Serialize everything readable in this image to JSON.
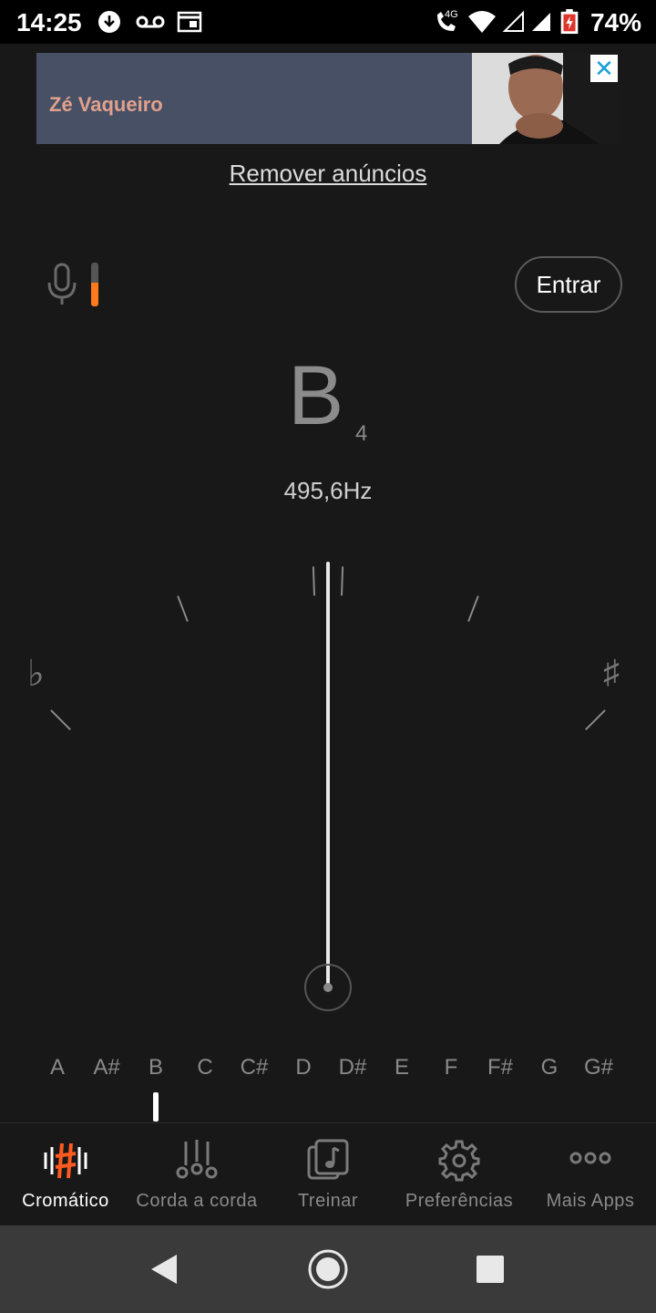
{
  "status_bar": {
    "time": "14:25",
    "network": "4G",
    "battery": "74%"
  },
  "ad": {
    "title": "Zé Vaqueiro",
    "close_icon": "close-icon"
  },
  "remove_ads_label": "Remover anúncios",
  "input_level_fraction": 0.55,
  "login_label": "Entrar",
  "tuner": {
    "note": "B",
    "octave": "4",
    "frequency": "495,6Hz",
    "flat_symbol": "♭",
    "sharp_symbol": "♯",
    "needle_cents": 0
  },
  "notes": [
    "A",
    "A#",
    "B",
    "C",
    "C#",
    "D",
    "D#",
    "E",
    "F",
    "F#",
    "G",
    "G#"
  ],
  "selected_note": "B",
  "nav": [
    {
      "label": "Cromático",
      "icon": "chromatic-icon",
      "active": true
    },
    {
      "label": "Corda a corda",
      "icon": "strings-icon",
      "active": false
    },
    {
      "label": "Treinar",
      "icon": "music-note-icon",
      "active": false
    },
    {
      "label": "Preferências",
      "icon": "gear-icon",
      "active": false
    },
    {
      "label": "Mais Apps",
      "icon": "more-dots-icon",
      "active": false
    }
  ],
  "colors": {
    "accent": "#ff7a1a",
    "background": "#181818"
  }
}
